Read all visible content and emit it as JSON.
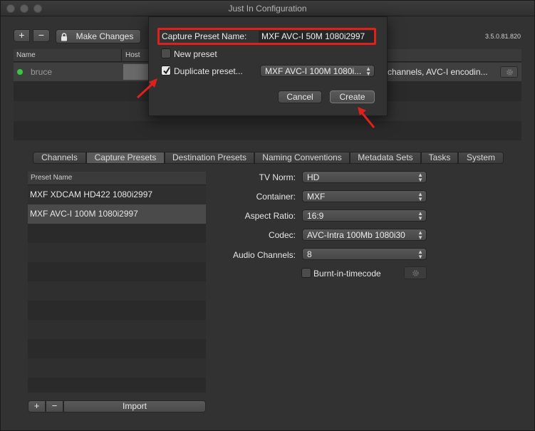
{
  "window": {
    "title": "Just In Configuration",
    "version": "3.5.0.81.820"
  },
  "toolbar": {
    "add": "+",
    "remove": "−",
    "make_changes": "Make Changes"
  },
  "host_table": {
    "headers": [
      "Name",
      "Host"
    ],
    "row": {
      "name": "bruce",
      "status_color": "#39c93f",
      "detail": "channels, AVC-I encodin..."
    }
  },
  "dialog": {
    "name_label": "Capture Preset Name:",
    "name_value": "MXF AVC-I 50M 1080i2997",
    "new_preset": "New preset",
    "duplicate_preset": "Duplicate preset...",
    "duplicate_source": "MXF AVC-I 100M 1080i...",
    "cancel": "Cancel",
    "create": "Create",
    "highlight_color": "#e0211b"
  },
  "tabs": [
    "Channels",
    "Capture Presets",
    "Destination Presets",
    "Naming Conventions",
    "Metadata Sets",
    "Tasks",
    "System"
  ],
  "active_tab": "Capture Presets",
  "presets": {
    "header": "Preset Name",
    "items": [
      "MXF XDCAM HD422 1080i2997",
      "MXF AVC-I 100M 1080i2997"
    ],
    "selected": "MXF AVC-I 100M 1080i2997",
    "add": "+",
    "remove": "−",
    "import": "Import"
  },
  "settings": {
    "tv_norm": {
      "label": "TV Norm:",
      "value": "HD"
    },
    "container": {
      "label": "Container:",
      "value": "MXF"
    },
    "aspect_ratio": {
      "label": "Aspect Ratio:",
      "value": "16:9"
    },
    "codec": {
      "label": "Codec:",
      "value": "AVC-Intra 100Mb 1080i30"
    },
    "audio_channels": {
      "label": "Audio Channels:",
      "value": "8"
    },
    "burnin": {
      "label": "Burnt-in-timecode"
    }
  }
}
